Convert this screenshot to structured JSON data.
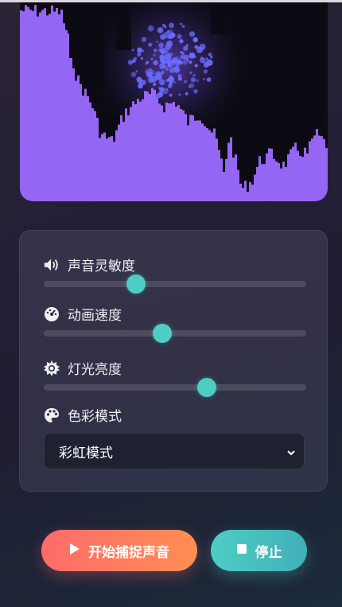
{
  "controls": {
    "sensitivity": {
      "label": "声音灵敏度",
      "value": 0.35
    },
    "speed": {
      "label": "动画速度",
      "value": 0.45
    },
    "brightness": {
      "label": "灯光亮度",
      "value": 0.62
    },
    "color_mode": {
      "label": "色彩模式",
      "selected": "彩虹模式"
    }
  },
  "buttons": {
    "start_label": "开始捕捉声音",
    "stop_label": "停止"
  },
  "colors": {
    "accent": "#4ecdc4",
    "start_gradient": [
      "#ff6b6b",
      "#ff8e53"
    ],
    "stop_gradient": [
      "#4ecdc4",
      "#40b0b8"
    ],
    "viz_bar": "#9d6bff",
    "viz_particle": "#6a6bff"
  },
  "icons": {
    "sensitivity": "volume-icon",
    "speed": "speedometer-icon",
    "brightness": "sun-icon",
    "color_mode": "palette-icon",
    "start": "play-icon",
    "stop": "stop-icon"
  }
}
